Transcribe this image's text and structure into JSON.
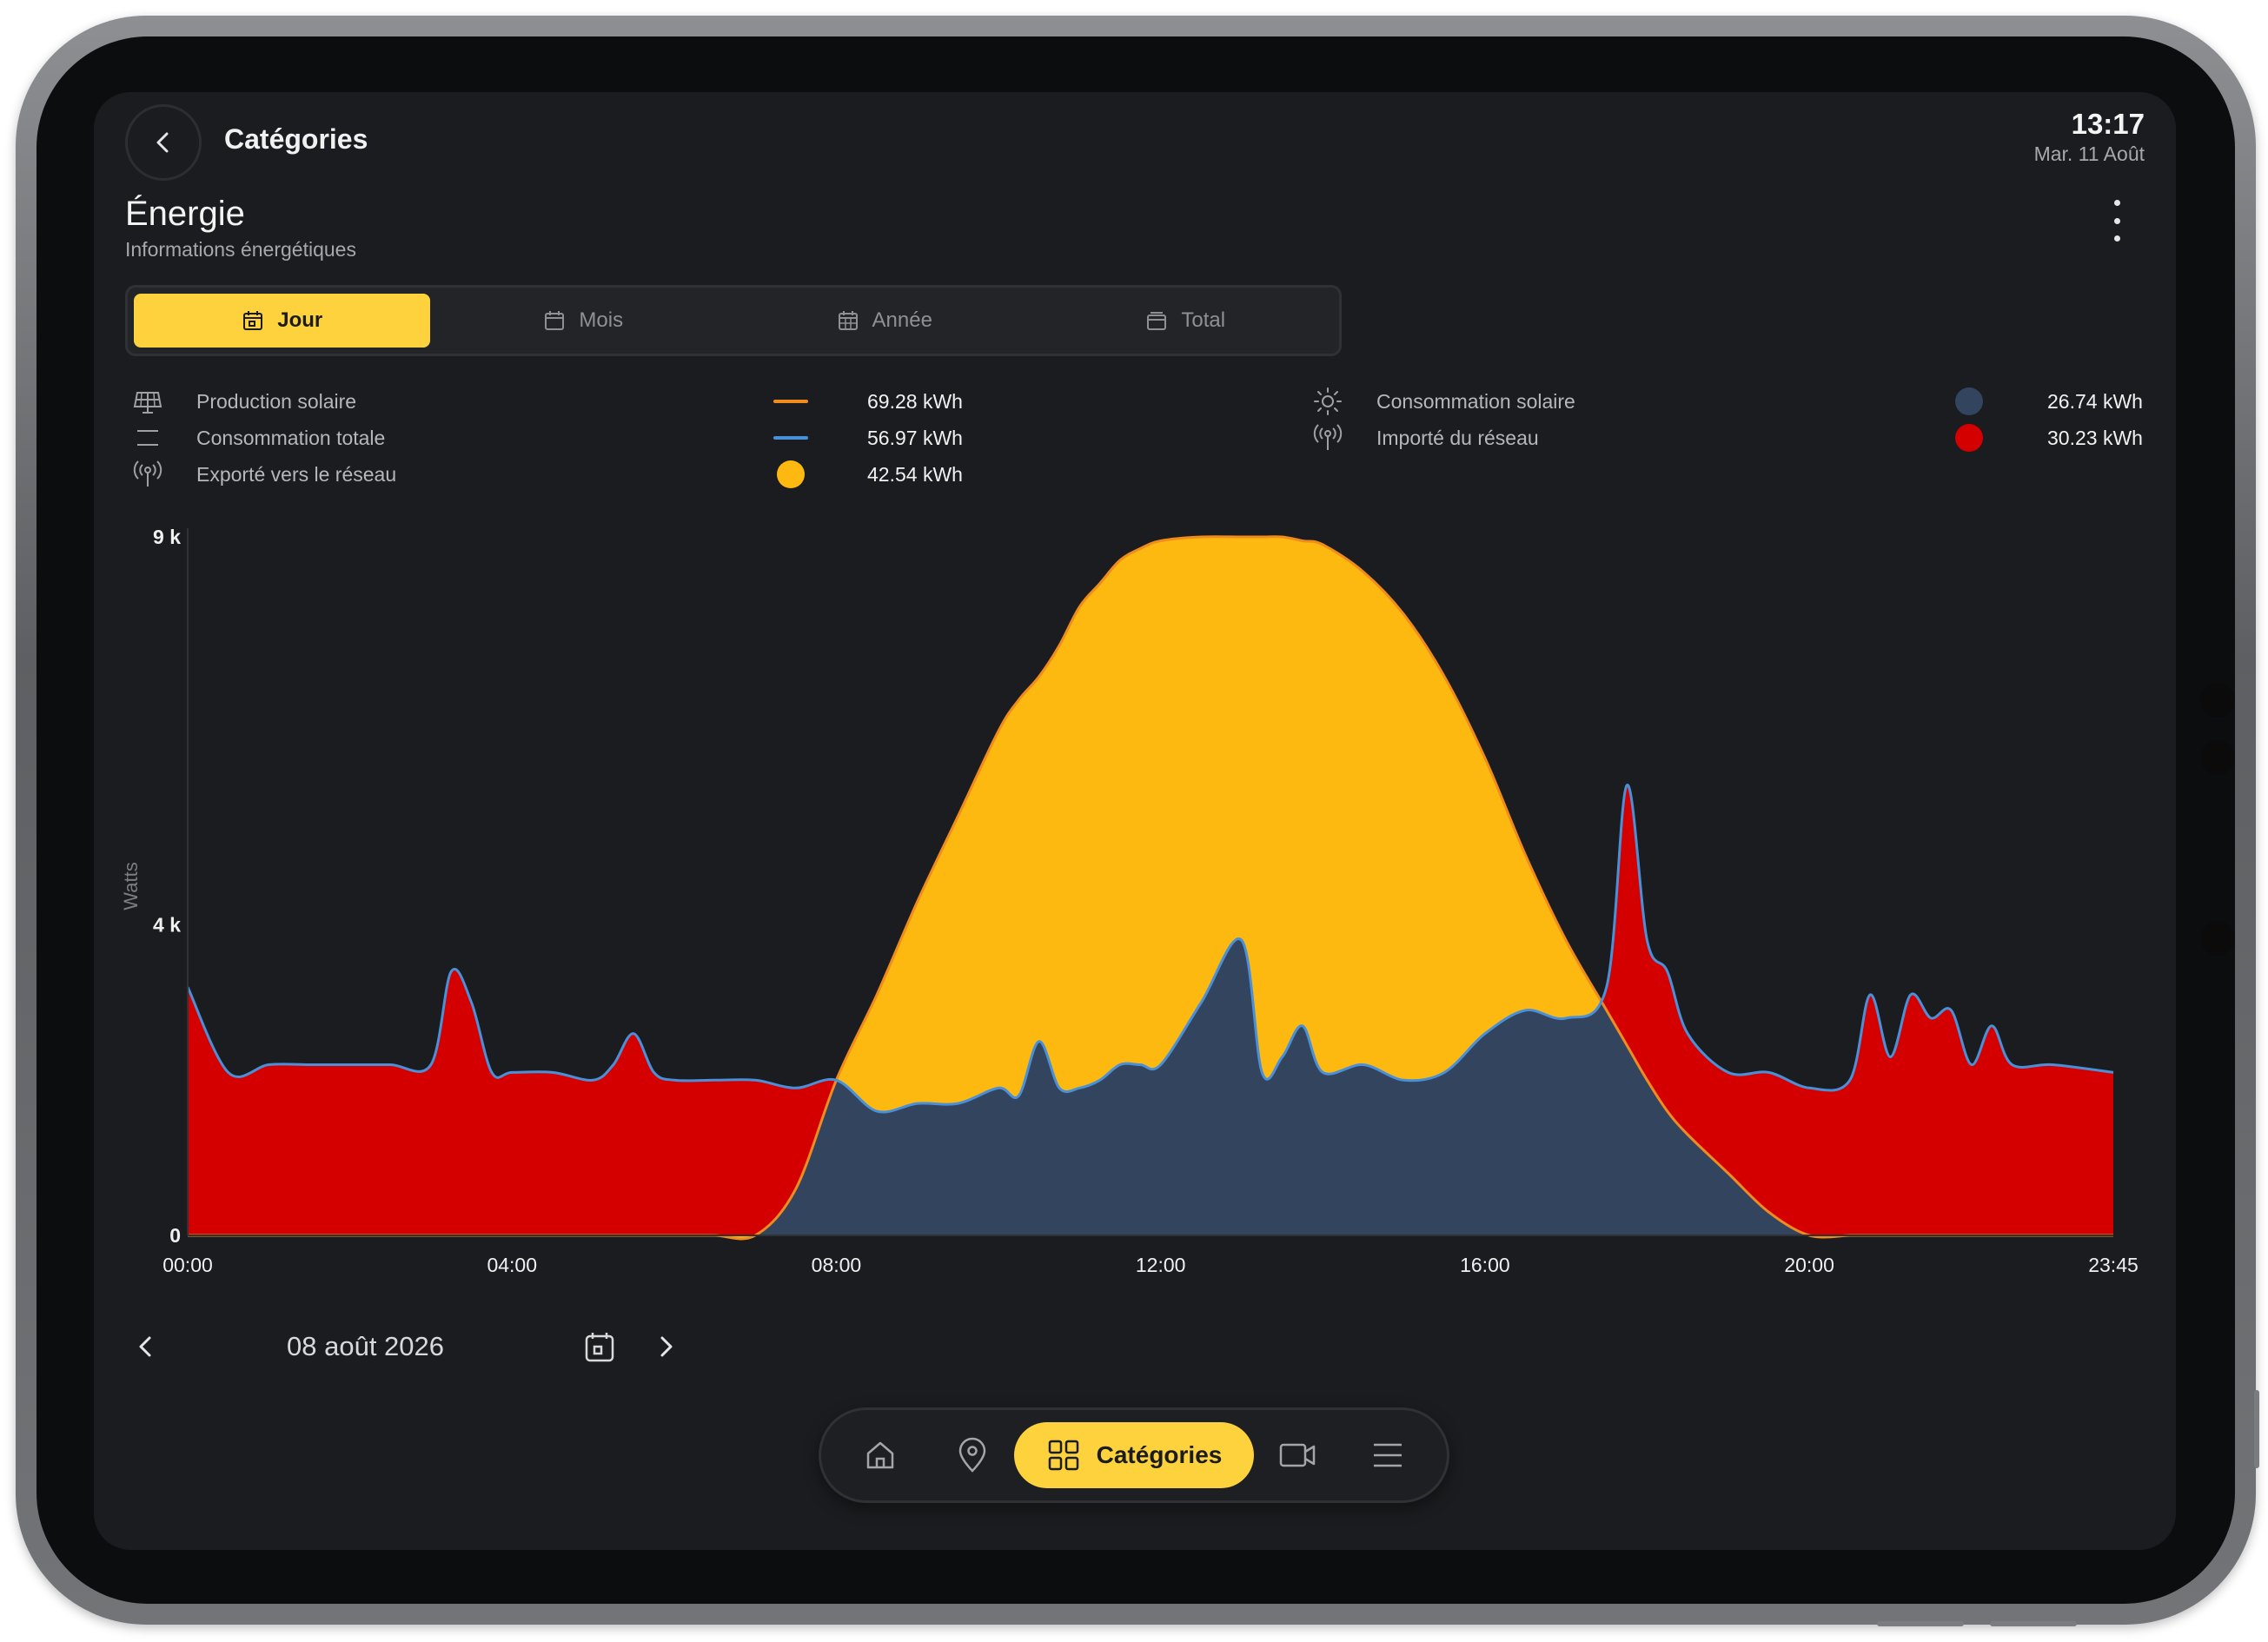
{
  "header": {
    "title": "Catégories",
    "time": "13:17",
    "date": "Mar. 11 Août"
  },
  "page": {
    "title": "Énergie",
    "subtitle": "Informations énergétiques"
  },
  "tabs": [
    {
      "label": "Jour",
      "icon": "calendar-day-icon",
      "active": true
    },
    {
      "label": "Mois",
      "icon": "calendar-icon",
      "active": false
    },
    {
      "label": "Année",
      "icon": "calendar-grid-icon",
      "active": false
    },
    {
      "label": "Total",
      "icon": "calendar-stack-icon",
      "active": false
    }
  ],
  "legend": [
    {
      "label": "Production solaire",
      "value": "69.28 kWh",
      "icon": "solar-panel-icon",
      "marker": "line",
      "color": "#f08c1e"
    },
    {
      "label": "Consommation totale",
      "value": "56.97 kWh",
      "icon": "lines-icon",
      "marker": "line",
      "color": "#4a90d9"
    },
    {
      "label": "Exporté vers le réseau",
      "value": "42.54 kWh",
      "icon": "broadcast-icon",
      "marker": "dot",
      "color": "#fdb90f"
    },
    {
      "label": "Consommation solaire",
      "value": "26.74 kWh",
      "icon": "sun-icon",
      "marker": "dot",
      "color": "#33445f"
    },
    {
      "label": "Importé du réseau",
      "value": "30.23 kWh",
      "icon": "broadcast-icon",
      "marker": "dot",
      "color": "#d40000"
    }
  ],
  "date_nav": {
    "label": "08 août 2026"
  },
  "bottom_nav": {
    "items": [
      {
        "name": "home",
        "icon": "home-icon"
      },
      {
        "name": "location",
        "icon": "location-pin-icon"
      },
      {
        "name": "categories",
        "icon": "grid-icon",
        "label": "Catégories",
        "active": true
      },
      {
        "name": "camera",
        "icon": "video-camera-icon"
      },
      {
        "name": "menu",
        "icon": "menu-icon"
      }
    ]
  },
  "chart_data": {
    "type": "area",
    "ylabel": "Watts",
    "ylim": [
      0,
      9000
    ],
    "yticks": [
      0,
      4000,
      9000
    ],
    "ytick_labels": [
      "0",
      "4 k",
      "9 k"
    ],
    "xlim": [
      "00:00",
      "23:45"
    ],
    "xtick_labels": [
      "00:00",
      "04:00",
      "08:00",
      "12:00",
      "16:00",
      "20:00",
      "23:45"
    ],
    "grid": false,
    "colors": {
      "production": "#f08c1e",
      "consumption": "#4a90d9",
      "exported": "#fdb90f",
      "solar_consumption": "#33445f",
      "imported": "#d40000"
    },
    "x": [
      "00:00",
      "00:30",
      "01:00",
      "01:30",
      "02:00",
      "02:30",
      "03:00",
      "03:15",
      "03:30",
      "03:45",
      "04:00",
      "04:30",
      "05:00",
      "05:15",
      "05:30",
      "05:45",
      "06:00",
      "06:30",
      "07:00",
      "07:30",
      "08:00",
      "08:30",
      "09:00",
      "09:30",
      "10:00",
      "10:15",
      "10:30",
      "10:45",
      "11:00",
      "11:15",
      "11:30",
      "11:45",
      "12:00",
      "12:30",
      "13:00",
      "13:15",
      "13:30",
      "13:45",
      "14:00",
      "14:30",
      "15:00",
      "15:30",
      "16:00",
      "16:30",
      "17:00",
      "17:30",
      "17:45",
      "18:00",
      "18:15",
      "18:30",
      "19:00",
      "19:30",
      "20:00",
      "20:30",
      "20:45",
      "21:00",
      "21:15",
      "21:30",
      "21:45",
      "22:00",
      "22:15",
      "22:30",
      "23:00",
      "23:45"
    ],
    "series": [
      {
        "name": "Production solaire",
        "values": [
          0,
          0,
          0,
          0,
          0,
          0,
          0,
          0,
          0,
          0,
          0,
          0,
          0,
          0,
          0,
          0,
          0,
          0,
          0,
          600,
          2000,
          3100,
          4300,
          5400,
          6500,
          6900,
          7200,
          7600,
          8100,
          8400,
          8700,
          8850,
          8950,
          9000,
          9000,
          9000,
          9000,
          8950,
          8900,
          8550,
          8000,
          7200,
          6150,
          4900,
          3800,
          2900,
          2450,
          2000,
          1600,
          1300,
          800,
          300,
          0,
          0,
          0,
          0,
          0,
          0,
          0,
          0,
          0,
          0,
          0,
          0
        ]
      },
      {
        "name": "Consommation totale",
        "values": [
          3200,
          2100,
          2200,
          2200,
          2200,
          2200,
          2200,
          3400,
          3000,
          2100,
          2100,
          2100,
          2000,
          2200,
          2600,
          2100,
          2000,
          2000,
          2000,
          1900,
          2000,
          1600,
          1700,
          1700,
          1900,
          1800,
          2500,
          1900,
          1900,
          2000,
          2200,
          2200,
          2200,
          3000,
          3800,
          2100,
          2300,
          2700,
          2100,
          2200,
          2000,
          2100,
          2600,
          2900,
          2800,
          3200,
          5800,
          3800,
          3400,
          2600,
          2100,
          2100,
          1900,
          2000,
          3100,
          2300,
          3100,
          2800,
          2900,
          2200,
          2700,
          2200,
          2200,
          2100
        ]
      }
    ]
  }
}
